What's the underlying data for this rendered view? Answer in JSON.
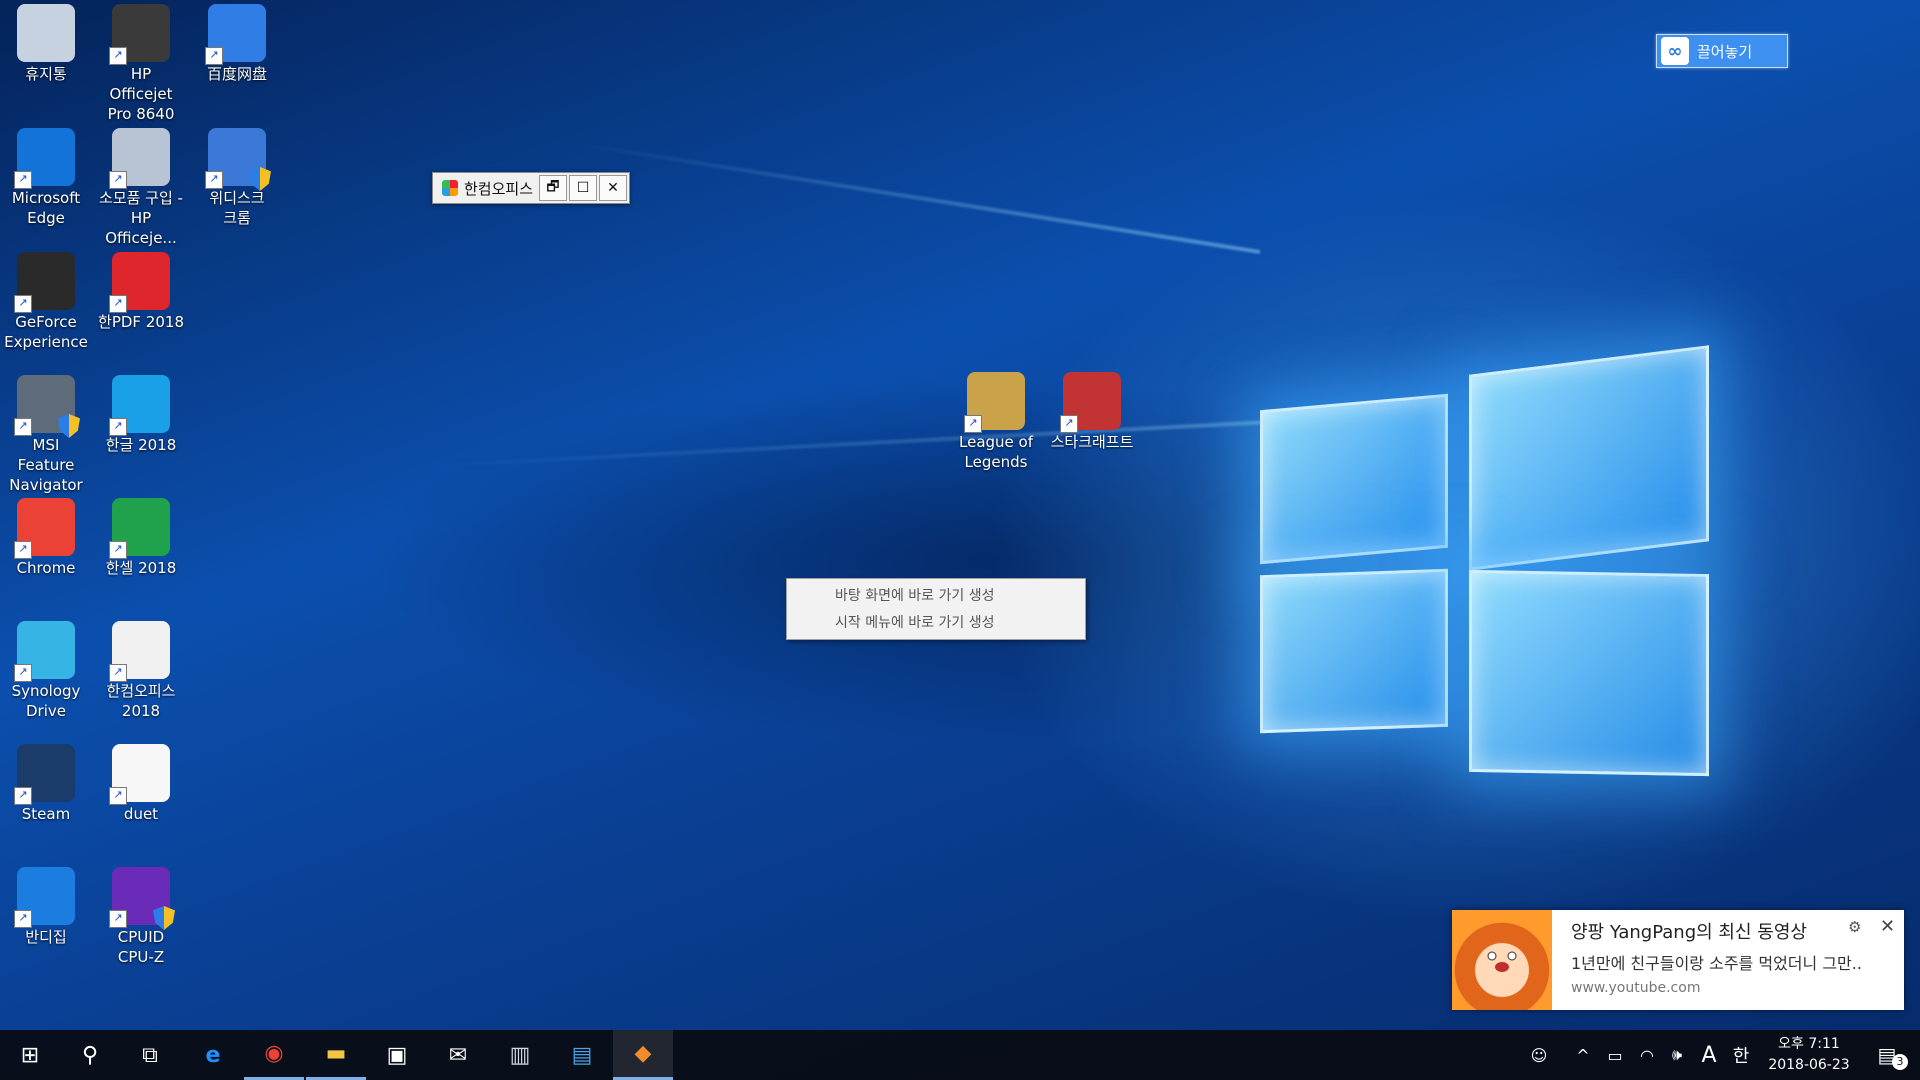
{
  "desktop_icons": [
    {
      "id": "recycle",
      "label": "휴지통",
      "icon": "recycle-bin-icon",
      "color": "#c7d2e0"
    },
    {
      "id": "hp8640",
      "label": "HP Officejet\nPro 8640",
      "icon": "printer-icon",
      "color": "#3a3a3a"
    },
    {
      "id": "baidu",
      "label": "百度网盘",
      "icon": "baidu-netdisk-icon",
      "color": "#2f7de5"
    },
    {
      "id": "edge",
      "label": "Microsoft\nEdge",
      "icon": "edge-icon",
      "color": "#1473d8"
    },
    {
      "id": "hpshop",
      "label": "소모품 구입 -\nHP Officeje...",
      "icon": "printer-supplies-icon",
      "color": "#b8c4d4"
    },
    {
      "id": "wedisk",
      "label": "위디스크\n크롬",
      "icon": "wedisk-icon",
      "color": "#3b78d8"
    },
    {
      "id": "geforce",
      "label": "GeForce\nExperience",
      "icon": "geforce-icon",
      "color": "#2a2a2a"
    },
    {
      "id": "hanpdf",
      "label": "한PDF 2018",
      "icon": "hanpdf-icon",
      "color": "#e0262d"
    },
    {
      "id": "msi",
      "label": "MSI Feature\nNavigator",
      "icon": "msi-icon",
      "color": "#5e6b7a"
    },
    {
      "id": "hangul",
      "label": "한글 2018",
      "icon": "hangul-icon",
      "color": "#1aa0e6"
    },
    {
      "id": "chrome",
      "label": "Chrome",
      "icon": "chrome-icon",
      "color": "#ea4335"
    },
    {
      "id": "hancell",
      "label": "한셀 2018",
      "icon": "hancell-icon",
      "color": "#1fa24b"
    },
    {
      "id": "synology",
      "label": "Synology\nDrive",
      "icon": "synology-drive-icon",
      "color": "#36b4e6"
    },
    {
      "id": "hancom",
      "label": "한컴오피스\n2018",
      "icon": "hancom-office-icon",
      "color": "#f1f1f1"
    },
    {
      "id": "steam",
      "label": "Steam",
      "icon": "steam-icon",
      "color": "#1b3b6a"
    },
    {
      "id": "duet",
      "label": "duet",
      "icon": "duet-icon",
      "color": "#f7f7f7"
    },
    {
      "id": "bandizip",
      "label": "반디집",
      "icon": "bandizip-icon",
      "color": "#1c7de0"
    },
    {
      "id": "cpuz",
      "label": "CPUID\nCPU-Z",
      "icon": "cpuz-icon",
      "color": "#6a2bb8"
    },
    {
      "id": "lol",
      "label": "League of\nLegends",
      "icon": "league-of-legends-icon",
      "color": "#c9a24a"
    },
    {
      "id": "starcraft",
      "label": "스타크래프트",
      "icon": "starcraft-icon",
      "color": "#c23434"
    }
  ],
  "floating_bar": {
    "title": "한컴오피스",
    "restore": "🗗",
    "maximize": "☐",
    "close": "✕"
  },
  "context_menu": {
    "items": [
      "바탕 화면에 바로 가기 생성",
      "시작 메뉴에 바로 가기 생성"
    ]
  },
  "baidu_button": {
    "label": "끌어놓기"
  },
  "notification": {
    "title": "양팡 YangPang의 최신 동영상",
    "body": "1년만에 친구들이랑 소주를 먹었더니 그만..",
    "source": "www.youtube.com",
    "settings_glyph": "⚙",
    "close_glyph": "✕"
  },
  "taskbar": {
    "start_glyph": "⊞",
    "search_glyph": "⚲",
    "taskview_glyph": "⧉",
    "apps": [
      {
        "name": "edge",
        "glyph": "e",
        "color": "#1e8fff"
      },
      {
        "name": "chrome",
        "glyph": "◉",
        "color": "#ea4335"
      },
      {
        "name": "file-explorer",
        "glyph": "▬",
        "color": "#f4c542"
      },
      {
        "name": "store",
        "glyph": "▣",
        "color": "#ffffff"
      },
      {
        "name": "mail",
        "glyph": "✉",
        "color": "#ffffff"
      },
      {
        "name": "app-scan",
        "glyph": "▥",
        "color": "#cfd8e3"
      },
      {
        "name": "app-remote",
        "glyph": "▤",
        "color": "#4aa3e8"
      },
      {
        "name": "hancom",
        "glyph": "◆",
        "color": "#f08c2a"
      }
    ],
    "tray": {
      "people": "☺",
      "chevron": "^",
      "battery": "▭",
      "wifi": "◠",
      "volume": "🕪",
      "ime_a": "A",
      "ime_han": "한",
      "notif": "▤",
      "notif_count": "3"
    },
    "clock": {
      "time": "오후 7:11",
      "date": "2018-06-23"
    }
  }
}
